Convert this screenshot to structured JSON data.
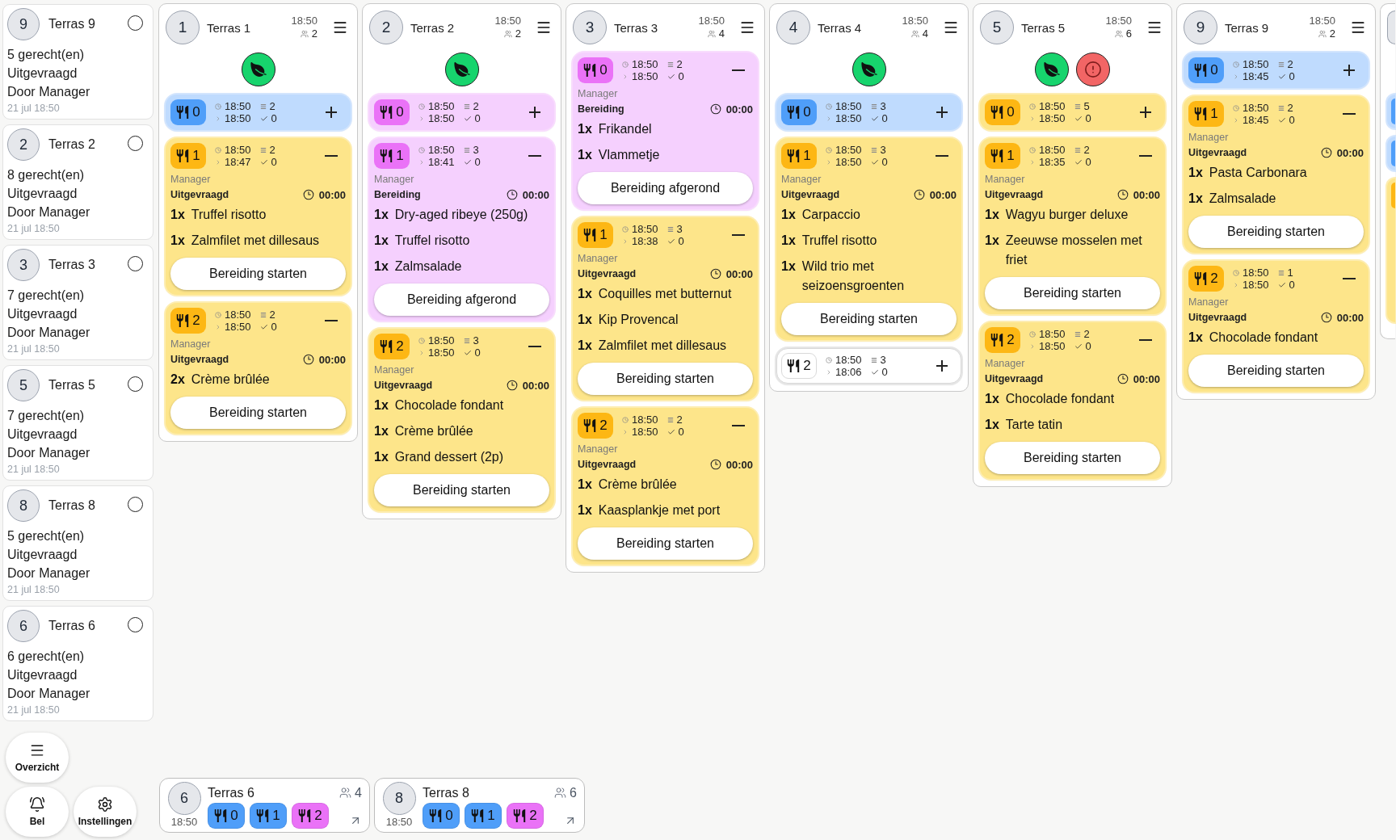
{
  "sidebar": {
    "orders": [
      {
        "table_number": "9",
        "table_name": "Terras 9",
        "selected": false,
        "dish_count": "5 gerecht(en)",
        "status": "Uitgevraagd",
        "requested_by": "Door Manager",
        "timestamp": "21 jul 18:50"
      },
      {
        "table_number": "2",
        "table_name": "Terras 2",
        "selected": false,
        "dish_count": "8 gerecht(en)",
        "status": "Uitgevraagd",
        "requested_by": "Door Manager",
        "timestamp": "21 jul 18:50"
      },
      {
        "table_number": "3",
        "table_name": "Terras 3",
        "selected": false,
        "dish_count": "7 gerecht(en)",
        "status": "Uitgevraagd",
        "requested_by": "Door Manager",
        "timestamp": "21 jul 18:50"
      },
      {
        "table_number": "5",
        "table_name": "Terras 5",
        "selected": false,
        "dish_count": "7 gerecht(en)",
        "status": "Uitgevraagd",
        "requested_by": "Door Manager",
        "timestamp": "21 jul 18:50"
      },
      {
        "table_number": "8",
        "table_name": "Terras 8",
        "selected": false,
        "dish_count": "5 gerecht(en)",
        "status": "Uitgevraagd",
        "requested_by": "Door Manager",
        "timestamp": "21 jul 18:50"
      },
      {
        "table_number": "6",
        "table_name": "Terras 6",
        "selected": false,
        "dish_count": "6 gerecht(en)",
        "status": "Uitgevraagd",
        "requested_by": "Door Manager",
        "timestamp": "21 jul 18:50"
      }
    ]
  },
  "nav_buttons": [
    {
      "kind": "overview",
      "label": "Overzicht"
    },
    {
      "kind": "bell",
      "label": "Bel"
    },
    {
      "kind": "settings",
      "label": "Instellingen"
    }
  ],
  "columns": [
    {
      "table_number": "1",
      "table_name": "Terras 1",
      "time": "18:50",
      "guests": "2",
      "alerts": [
        {
          "kind": "leaf"
        }
      ],
      "tickets": [
        {
          "course": "0",
          "kind": "done",
          "expanded": false,
          "start_time": "18:50",
          "dish_total": "2",
          "due_time": "18:50",
          "done_count": "0"
        },
        {
          "course": "1",
          "kind": "requested",
          "expanded": true,
          "start_time": "18:50",
          "dish_total": "2",
          "due_time": "18:47",
          "done_count": "0",
          "author": "Manager",
          "status": "Uitgevraagd",
          "timer": "00:00",
          "items": [
            {
              "qty": "1x",
              "name": "Truffel risotto"
            },
            {
              "qty": "1x",
              "name": "Zalmfilet met dillesaus"
            }
          ],
          "action": "Bereiding starten"
        },
        {
          "course": "2",
          "kind": "requested",
          "expanded": true,
          "start_time": "18:50",
          "dish_total": "2",
          "due_time": "18:50",
          "done_count": "0",
          "author": "Manager",
          "status": "Uitgevraagd",
          "timer": "00:00",
          "items": [
            {
              "qty": "2x",
              "name": "Crème brûlée"
            }
          ],
          "action": "Bereiding starten"
        }
      ]
    },
    {
      "table_number": "2",
      "table_name": "Terras 2",
      "time": "18:50",
      "guests": "2",
      "alerts": [
        {
          "kind": "leaf"
        }
      ],
      "tickets": [
        {
          "course": "0",
          "kind": "preparing",
          "expanded": false,
          "start_time": "18:50",
          "dish_total": "2",
          "due_time": "18:50",
          "done_count": "0"
        },
        {
          "course": "1",
          "kind": "preparing",
          "expanded": true,
          "start_time": "18:50",
          "dish_total": "3",
          "due_time": "18:41",
          "done_count": "0",
          "author": "Manager",
          "status": "Bereiding",
          "timer": "00:00",
          "items": [
            {
              "qty": "1x",
              "name": "Dry-aged ribeye (250g)"
            },
            {
              "qty": "1x",
              "name": "Truffel risotto"
            },
            {
              "qty": "1x",
              "name": "Zalmsalade"
            }
          ],
          "action": "Bereiding afgerond"
        },
        {
          "course": "2",
          "kind": "requested",
          "expanded": true,
          "start_time": "18:50",
          "dish_total": "3",
          "due_time": "18:50",
          "done_count": "0",
          "author": "Manager",
          "status": "Uitgevraagd",
          "timer": "00:00",
          "items": [
            {
              "qty": "1x",
              "name": "Chocolade fondant"
            },
            {
              "qty": "1x",
              "name": "Crème brûlée"
            },
            {
              "qty": "1x",
              "name": "Grand dessert (2p)"
            }
          ],
          "action": "Bereiding starten"
        }
      ]
    },
    {
      "table_number": "3",
      "table_name": "Terras 3",
      "time": "18:50",
      "guests": "4",
      "tickets": [
        {
          "course": "0",
          "kind": "preparing",
          "expanded": true,
          "start_time": "18:50",
          "dish_total": "2",
          "due_time": "18:50",
          "done_count": "0",
          "author": "Manager",
          "status": "Bereiding",
          "timer": "00:00",
          "items": [
            {
              "qty": "1x",
              "name": "Frikandel"
            },
            {
              "qty": "1x",
              "name": "Vlammetje"
            }
          ],
          "action": "Bereiding afgerond"
        },
        {
          "course": "1",
          "kind": "requested",
          "expanded": true,
          "start_time": "18:50",
          "dish_total": "3",
          "due_time": "18:38",
          "done_count": "0",
          "author": "Manager",
          "status": "Uitgevraagd",
          "timer": "00:00",
          "items": [
            {
              "qty": "1x",
              "name": "Coquilles met butternut"
            },
            {
              "qty": "1x",
              "name": "Kip Provencal"
            },
            {
              "qty": "1x",
              "name": "Zalmfilet met dillesaus"
            }
          ],
          "action": "Bereiding starten"
        },
        {
          "course": "2",
          "kind": "requested",
          "expanded": true,
          "start_time": "18:50",
          "dish_total": "2",
          "due_time": "18:50",
          "done_count": "0",
          "author": "Manager",
          "status": "Uitgevraagd",
          "timer": "00:00",
          "items": [
            {
              "qty": "1x",
              "name": "Crème brûlée"
            },
            {
              "qty": "1x",
              "name": "Kaasplankje met port"
            }
          ],
          "action": "Bereiding starten"
        }
      ]
    },
    {
      "table_number": "4",
      "table_name": "Terras 4",
      "time": "18:50",
      "guests": "4",
      "alerts": [
        {
          "kind": "leaf"
        }
      ],
      "tickets": [
        {
          "course": "0",
          "kind": "done",
          "expanded": false,
          "start_time": "18:50",
          "dish_total": "3",
          "due_time": "18:50",
          "done_count": "0"
        },
        {
          "course": "1",
          "kind": "requested",
          "expanded": true,
          "start_time": "18:50",
          "dish_total": "3",
          "due_time": "18:50",
          "done_count": "0",
          "author": "Manager",
          "status": "Uitgevraagd",
          "timer": "00:00",
          "items": [
            {
              "qty": "1x",
              "name": "Carpaccio"
            },
            {
              "qty": "1x",
              "name": "Truffel risotto"
            },
            {
              "qty": "1x",
              "name": "Wild trio met seizoensgroenten"
            }
          ],
          "action": "Bereiding starten"
        },
        {
          "course": "2",
          "kind": "waiting",
          "expanded": false,
          "start_time": "18:50",
          "dish_total": "3",
          "due_time": "18:06",
          "done_count": "0"
        }
      ]
    },
    {
      "table_number": "5",
      "table_name": "Terras 5",
      "time": "18:50",
      "guests": "6",
      "alerts": [
        {
          "kind": "leaf"
        },
        {
          "kind": "alert"
        }
      ],
      "tickets": [
        {
          "course": "0",
          "kind": "requested",
          "expanded": false,
          "start_time": "18:50",
          "dish_total": "5",
          "due_time": "18:50",
          "done_count": "0"
        },
        {
          "course": "1",
          "kind": "requested",
          "expanded": true,
          "start_time": "18:50",
          "dish_total": "2",
          "due_time": "18:35",
          "done_count": "0",
          "author": "Manager",
          "status": "Uitgevraagd",
          "timer": "00:00",
          "items": [
            {
              "qty": "1x",
              "name": "Wagyu burger deluxe"
            },
            {
              "qty": "1x",
              "name": "Zeeuwse mosselen met friet"
            }
          ],
          "action": "Bereiding starten"
        },
        {
          "course": "2",
          "kind": "requested",
          "expanded": true,
          "start_time": "18:50",
          "dish_total": "2",
          "due_time": "18:50",
          "done_count": "0",
          "author": "Manager",
          "status": "Uitgevraagd",
          "timer": "00:00",
          "items": [
            {
              "qty": "1x",
              "name": "Chocolade fondant"
            },
            {
              "qty": "1x",
              "name": "Tarte tatin"
            }
          ],
          "action": "Bereiding starten"
        }
      ]
    },
    {
      "table_number": "9",
      "table_name": "Terras 9",
      "time": "18:50",
      "guests": "2",
      "tickets": [
        {
          "course": "0",
          "kind": "done",
          "expanded": false,
          "start_time": "18:50",
          "dish_total": "2",
          "due_time": "18:45",
          "done_count": "0"
        },
        {
          "course": "1",
          "kind": "requested",
          "expanded": true,
          "start_time": "18:50",
          "dish_total": "2",
          "due_time": "18:45",
          "done_count": "0",
          "author": "Manager",
          "status": "Uitgevraagd",
          "timer": "00:00",
          "items": [
            {
              "qty": "1x",
              "name": "Pasta Carbonara"
            },
            {
              "qty": "1x",
              "name": "Zalmsalade"
            }
          ],
          "action": "Bereiding starten"
        },
        {
          "course": "2",
          "kind": "requested",
          "expanded": true,
          "start_time": "18:50",
          "dish_total": "1",
          "due_time": "18:50",
          "done_count": "0",
          "author": "Manager",
          "status": "Uitgevraagd",
          "timer": "00:00",
          "items": [
            {
              "qty": "1x",
              "name": "Chocolade fondant"
            }
          ],
          "action": "Bereiding starten"
        }
      ]
    }
  ],
  "offscreen_column": {
    "tickets": [
      {
        "kind": "done",
        "expanded": false
      },
      {
        "kind": "done",
        "expanded": false
      },
      {
        "kind": "requested",
        "expanded": true
      }
    ]
  },
  "dock": [
    {
      "table_number": "6",
      "table_name": "Terras 6",
      "time": "18:50",
      "guests": "4",
      "courses": [
        {
          "number": "0",
          "kind": "done"
        },
        {
          "number": "1",
          "kind": "done"
        },
        {
          "number": "2",
          "kind": "preparing"
        }
      ]
    },
    {
      "table_number": "8",
      "table_name": "Terras 8",
      "time": "18:50",
      "guests": "6",
      "courses": [
        {
          "number": "0",
          "kind": "done"
        },
        {
          "number": "1",
          "kind": "done"
        },
        {
          "number": "2",
          "kind": "preparing"
        }
      ]
    }
  ]
}
